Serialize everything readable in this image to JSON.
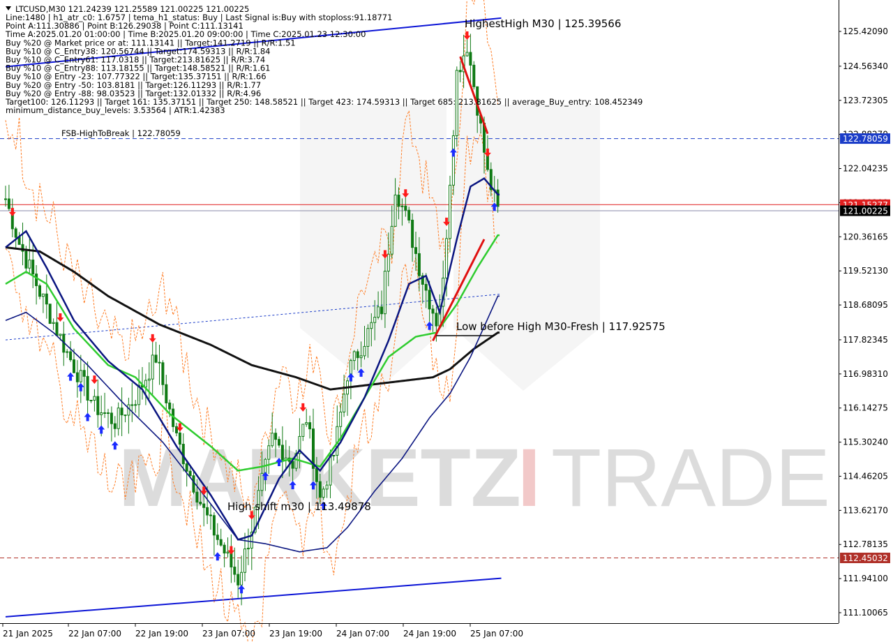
{
  "symbol_header": "LTCUSD,M30  121.24239 121.25589 121.00225 121.00225",
  "info_lines": [
    "Line:1480 | h1_atr_c0: 1.6757 | tema_h1_status: Buy | Last Signal is:Buy with stoploss:91.18771",
    "Point A:111.30886 | Point B:126.29038 | Point C:111.13141",
    "Time A:2025.01.20 01:00:00 | Time B:2025.01.20 09:00:00 | Time C:2025.01.23 12:30:00",
    "Buy %20 @ Market price or at: 111.13141 || Target:141.2719 || R/R:1.51",
    "Buy %10 @ C_Entry38: 120.56744 || Target:174.59313 || R/R:1.84",
    "Buy %10 @ C_Entry61: 117.0318 || Target:213.81625 || R/R:3.74",
    "Buy %10 @ C_Entry88: 113.18155 || Target:148.58521 || R/R:1.61",
    "Buy %10 @ Entry -23: 107.77322 || Target:135.37151 || R/R:1.66",
    "Buy %20 @ Entry -50: 103.8181 || Target:126.11293 || R/R:1.77",
    "Buy %20 @ Entry -88: 98.03523 || Target:132.01332 || R/R:4.96",
    "Target100: 126.11293 || Target 161: 135.37151 || Target 250: 148.58521 || Target 423: 174.59313 || Target 685: 213.81625 || average_Buy_entry: 108.452349",
    "minimum_distance_buy_levels: 3.53564 | ATR:1.42383"
  ],
  "annotations": {
    "highest_high": "HighestHigh   M30 | 125.39566",
    "fsb": "FSB-HighToBreak | 122.78059",
    "low_before_high": "Low before High   M30-Fresh | 117.92575",
    "high_shift": "High shift m30 | 113.49878"
  },
  "watermark": {
    "left": "MARKETZ",
    "i": "I",
    "right": "TRADE"
  },
  "price_badges": {
    "fsb": {
      "text": "122.78059",
      "price": 122.78059,
      "bg": "#1a3cc8",
      "fg": "#ffffff"
    },
    "red_line": {
      "text": "121.15277",
      "price": 121.15277,
      "bg": "#e02020",
      "fg": "#ffffff"
    },
    "current": {
      "text": "121.00225",
      "price": 121.00225,
      "bg": "#000000",
      "fg": "#ffffff"
    },
    "lower": {
      "text": "112.45032",
      "price": 112.45032,
      "bg": "#b03028",
      "fg": "#ffffff"
    }
  },
  "colors": {
    "trend_channel": "#0b14d6",
    "candle": "#0f7a14",
    "ma_black": "#111111",
    "ma_green": "#2ecc2e",
    "ma_navy": "#0a1580",
    "envelope": "#ff7a20",
    "signal_up": "#1a2cff",
    "signal_down": "#ff1a1a",
    "watermark": "#dcdcdc",
    "watermark_accent": "#f2c9c9"
  },
  "chart_data": {
    "type": "candlestick",
    "title": "LTCUSD,M30",
    "y_ticks": [
      "125.42090",
      "124.56340",
      "123.72305",
      "122.88270",
      "122.04235",
      "121.20200",
      "120.36165",
      "119.52130",
      "118.68095",
      "117.82345",
      "116.98310",
      "116.14275",
      "115.30240",
      "114.46205",
      "113.62170",
      "112.78135",
      "111.94100",
      "111.10065"
    ],
    "ylim": [
      110.9,
      125.9
    ],
    "x_ticks": [
      "21 Jan 2025",
      "22 Jan 07:00",
      "22 Jan 19:00",
      "23 Jan 07:00",
      "23 Jan 19:00",
      "24 Jan 07:00",
      "24 Jan 19:00",
      "25 Jan 07:00"
    ],
    "horizontal_levels": [
      {
        "name": "FSB-HighToBreak",
        "price": 122.78059,
        "style": "dashed",
        "color": "#1a3cc8"
      },
      {
        "name": "red_line",
        "price": 121.15277,
        "style": "solid",
        "color": "#e02020"
      },
      {
        "name": "current",
        "price": 121.00225,
        "style": "solid",
        "color": "#8a8aa8"
      },
      {
        "name": "lower",
        "price": 112.45032,
        "style": "dashed",
        "color": "#b03028"
      }
    ],
    "price_anchors": [
      {
        "bar": 0,
        "price": 121.3
      },
      {
        "bar": 4,
        "price": 120.2
      },
      {
        "bar": 10,
        "price": 119.0
      },
      {
        "bar": 18,
        "price": 117.5
      },
      {
        "bar": 26,
        "price": 116.2
      },
      {
        "bar": 32,
        "price": 115.8
      },
      {
        "bar": 38,
        "price": 116.4
      },
      {
        "bar": 44,
        "price": 117.4
      },
      {
        "bar": 50,
        "price": 115.4
      },
      {
        "bar": 58,
        "price": 113.6
      },
      {
        "bar": 64,
        "price": 112.6
      },
      {
        "bar": 68,
        "price": 111.9
      },
      {
        "bar": 72,
        "price": 113.2
      },
      {
        "bar": 78,
        "price": 115.4
      },
      {
        "bar": 84,
        "price": 114.8
      },
      {
        "bar": 88,
        "price": 115.9
      },
      {
        "bar": 92,
        "price": 113.9
      },
      {
        "bar": 96,
        "price": 115.0
      },
      {
        "bar": 100,
        "price": 117.0
      },
      {
        "bar": 106,
        "price": 118.0
      },
      {
        "bar": 110,
        "price": 118.6
      },
      {
        "bar": 114,
        "price": 121.6
      },
      {
        "bar": 118,
        "price": 120.6
      },
      {
        "bar": 122,
        "price": 119.3
      },
      {
        "bar": 126,
        "price": 118.3
      },
      {
        "bar": 128,
        "price": 119.2
      },
      {
        "bar": 132,
        "price": 124.4
      },
      {
        "bar": 135,
        "price": 125.1
      },
      {
        "bar": 138,
        "price": 123.6
      },
      {
        "bar": 141,
        "price": 121.9
      },
      {
        "bar": 144,
        "price": 121.0
      }
    ],
    "bar_count": 145,
    "moving_averages": [
      {
        "name": "ma_black",
        "anchors": [
          [
            0,
            120.1
          ],
          [
            10,
            120.0
          ],
          [
            20,
            119.5
          ],
          [
            30,
            118.9
          ],
          [
            45,
            118.2
          ],
          [
            60,
            117.7
          ],
          [
            72,
            117.2
          ],
          [
            85,
            116.9
          ],
          [
            95,
            116.6
          ],
          [
            105,
            116.7
          ],
          [
            115,
            116.8
          ],
          [
            125,
            116.9
          ],
          [
            130,
            117.1
          ],
          [
            137,
            117.6
          ],
          [
            144,
            118.0
          ]
        ]
      },
      {
        "name": "ma_green",
        "anchors": [
          [
            0,
            119.2
          ],
          [
            6,
            119.5
          ],
          [
            12,
            119.2
          ],
          [
            20,
            118.1
          ],
          [
            30,
            117.2
          ],
          [
            38,
            116.9
          ],
          [
            48,
            116.0
          ],
          [
            60,
            115.2
          ],
          [
            68,
            114.6
          ],
          [
            75,
            114.7
          ],
          [
            84,
            114.9
          ],
          [
            92,
            114.7
          ],
          [
            98,
            115.4
          ],
          [
            105,
            116.4
          ],
          [
            112,
            117.4
          ],
          [
            120,
            117.9
          ],
          [
            126,
            118.0
          ],
          [
            132,
            118.7
          ],
          [
            138,
            119.6
          ],
          [
            144,
            120.4
          ]
        ]
      },
      {
        "name": "ma_navy_fast",
        "anchors": [
          [
            0,
            120.1
          ],
          [
            6,
            120.5
          ],
          [
            12,
            119.6
          ],
          [
            20,
            118.3
          ],
          [
            30,
            117.3
          ],
          [
            40,
            116.6
          ],
          [
            50,
            115.2
          ],
          [
            60,
            114.0
          ],
          [
            68,
            112.9
          ],
          [
            72,
            113.0
          ],
          [
            80,
            114.4
          ],
          [
            86,
            115.1
          ],
          [
            92,
            114.6
          ],
          [
            98,
            115.3
          ],
          [
            105,
            116.4
          ],
          [
            112,
            117.8
          ],
          [
            118,
            119.2
          ],
          [
            123,
            119.4
          ],
          [
            127,
            118.5
          ],
          [
            132,
            120.3
          ],
          [
            136,
            121.6
          ],
          [
            140,
            121.8
          ],
          [
            144,
            121.4
          ]
        ]
      },
      {
        "name": "ma_navy_slow",
        "anchors": [
          [
            0,
            118.3
          ],
          [
            6,
            118.5
          ],
          [
            14,
            118.0
          ],
          [
            24,
            117.2
          ],
          [
            34,
            116.3
          ],
          [
            46,
            115.3
          ],
          [
            58,
            114.0
          ],
          [
            68,
            112.9
          ],
          [
            76,
            112.8
          ],
          [
            86,
            112.6
          ],
          [
            94,
            112.7
          ],
          [
            100,
            113.2
          ],
          [
            108,
            114.1
          ],
          [
            116,
            114.9
          ],
          [
            124,
            115.9
          ],
          [
            130,
            116.5
          ],
          [
            136,
            117.4
          ],
          [
            144,
            118.9
          ]
        ]
      }
    ],
    "trend_lines": [
      {
        "name": "channel_upper",
        "from": [
          0,
          124.55
        ],
        "to": [
          145,
          125.75
        ],
        "color": "#0b14d6",
        "width": 2
      },
      {
        "name": "channel_lower",
        "from": [
          0,
          111.0
        ],
        "to": [
          145,
          111.95
        ],
        "color": "#0b14d6",
        "width": 2
      },
      {
        "name": "channel_mid",
        "from": [
          0,
          117.82
        ],
        "to": [
          145,
          118.95
        ],
        "color": "#1a3cc8",
        "width": 1,
        "dash": true
      },
      {
        "name": "red_down",
        "from": [
          133,
          124.8
        ],
        "to": [
          141,
          122.9
        ],
        "color": "#e01010",
        "width": 3
      },
      {
        "name": "red_up",
        "from": [
          125,
          117.8
        ],
        "to": [
          140,
          120.3
        ],
        "color": "#e01010",
        "width": 3
      },
      {
        "name": "fresh_low_mark",
        "from": [
          126,
          117.92575
        ],
        "to": [
          143,
          117.92575
        ],
        "color": "#000000",
        "width": 1.5
      }
    ],
    "signals": [
      {
        "bar": 2,
        "dir": "down"
      },
      {
        "bar": 16,
        "dir": "down"
      },
      {
        "bar": 19,
        "dir": "up"
      },
      {
        "bar": 22,
        "dir": "up"
      },
      {
        "bar": 24,
        "dir": "up"
      },
      {
        "bar": 26,
        "dir": "down"
      },
      {
        "bar": 28,
        "dir": "up"
      },
      {
        "bar": 32,
        "dir": "up"
      },
      {
        "bar": 43,
        "dir": "down"
      },
      {
        "bar": 51,
        "dir": "down"
      },
      {
        "bar": 58,
        "dir": "down"
      },
      {
        "bar": 62,
        "dir": "up"
      },
      {
        "bar": 66,
        "dir": "down"
      },
      {
        "bar": 69,
        "dir": "up"
      },
      {
        "bar": 72,
        "dir": "down"
      },
      {
        "bar": 76,
        "dir": "up"
      },
      {
        "bar": 80,
        "dir": "up"
      },
      {
        "bar": 84,
        "dir": "up"
      },
      {
        "bar": 87,
        "dir": "down"
      },
      {
        "bar": 90,
        "dir": "up"
      },
      {
        "bar": 93,
        "dir": "up"
      },
      {
        "bar": 101,
        "dir": "up"
      },
      {
        "bar": 104,
        "dir": "up"
      },
      {
        "bar": 111,
        "dir": "down"
      },
      {
        "bar": 117,
        "dir": "down"
      },
      {
        "bar": 124,
        "dir": "up"
      },
      {
        "bar": 129,
        "dir": "down"
      },
      {
        "bar": 131,
        "dir": "up"
      },
      {
        "bar": 135,
        "dir": "down"
      },
      {
        "bar": 141,
        "dir": "down"
      },
      {
        "bar": 143,
        "dir": "up"
      }
    ]
  }
}
